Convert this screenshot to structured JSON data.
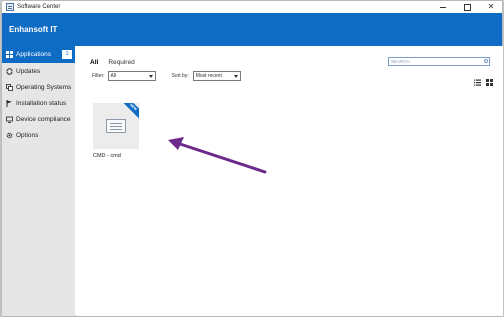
{
  "window": {
    "title": "Software Center"
  },
  "header": {
    "org_name": "Enhansoft IT"
  },
  "sidebar": {
    "items": [
      {
        "label": "Applications",
        "icon": "applications-icon",
        "badge": "1",
        "active": true
      },
      {
        "label": "Updates",
        "icon": "updates-icon"
      },
      {
        "label": "Operating Systems",
        "icon": "operating-systems-icon"
      },
      {
        "label": "Installation status",
        "icon": "flag-icon"
      },
      {
        "label": "Device compliance",
        "icon": "compliance-icon"
      },
      {
        "label": "Options",
        "icon": "gear-icon"
      }
    ]
  },
  "main": {
    "tabs": [
      {
        "label": "All",
        "active": true
      },
      {
        "label": "Required"
      }
    ],
    "search": {
      "placeholder": "SEARCH"
    },
    "filter": {
      "label": "Filter:",
      "value": "All"
    },
    "sort": {
      "label": "Sort by:",
      "value": "Most recent"
    },
    "apps": [
      {
        "name": "CMD - cmd",
        "ribbon": "NEW"
      }
    ]
  },
  "colors": {
    "accent": "#0e6cc4",
    "annotation_arrow": "#6b2a8c"
  }
}
